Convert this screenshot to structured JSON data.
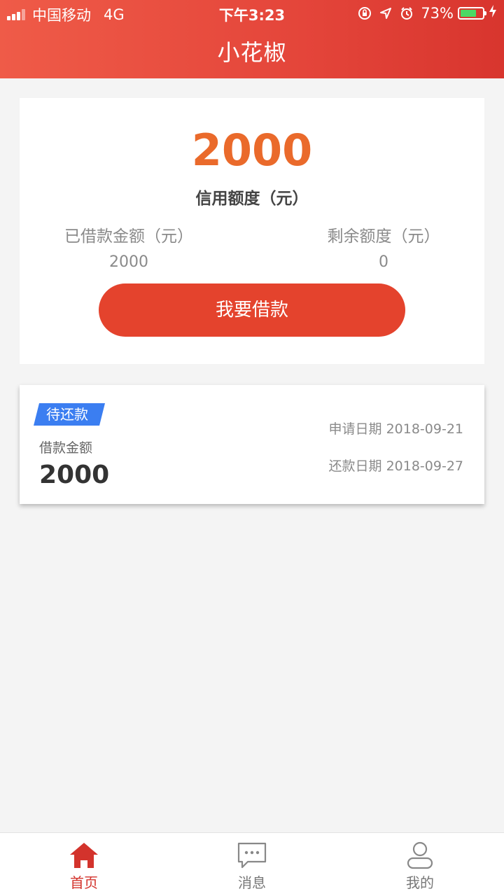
{
  "status_bar": {
    "carrier": "中国移动",
    "network": "4G",
    "time": "下午3:23",
    "battery_percent": "73%",
    "battery_level": 0.73,
    "battery_color": "#4cd964"
  },
  "header": {
    "title": "小花椒",
    "gradient_colors": [
      "#ef5b48",
      "#d8352e"
    ]
  },
  "credit": {
    "amount": "2000",
    "label": "信用额度（元）",
    "borrowed_label": "已借款金额（元）",
    "borrowed_value": "2000",
    "remaining_label": "剩余额度（元）",
    "remaining_value": "0",
    "borrow_button": "我要借款",
    "accent_color": "#ea6a2b",
    "button_color": "#e4432d"
  },
  "loan": {
    "status_badge": "待还款",
    "badge_color": "#3b7ef1",
    "amount_label": "借款金额",
    "amount": "2000",
    "apply_date_label": "申请日期",
    "apply_date": "2018-09-21",
    "repay_date_label": "还款日期",
    "repay_date": "2018-09-27"
  },
  "nav": {
    "items": [
      {
        "label": "首页",
        "icon": "home-icon",
        "active": true
      },
      {
        "label": "消息",
        "icon": "message-icon",
        "active": false
      },
      {
        "label": "我的",
        "icon": "user-icon",
        "active": false
      }
    ],
    "active_color": "#d3332c"
  }
}
